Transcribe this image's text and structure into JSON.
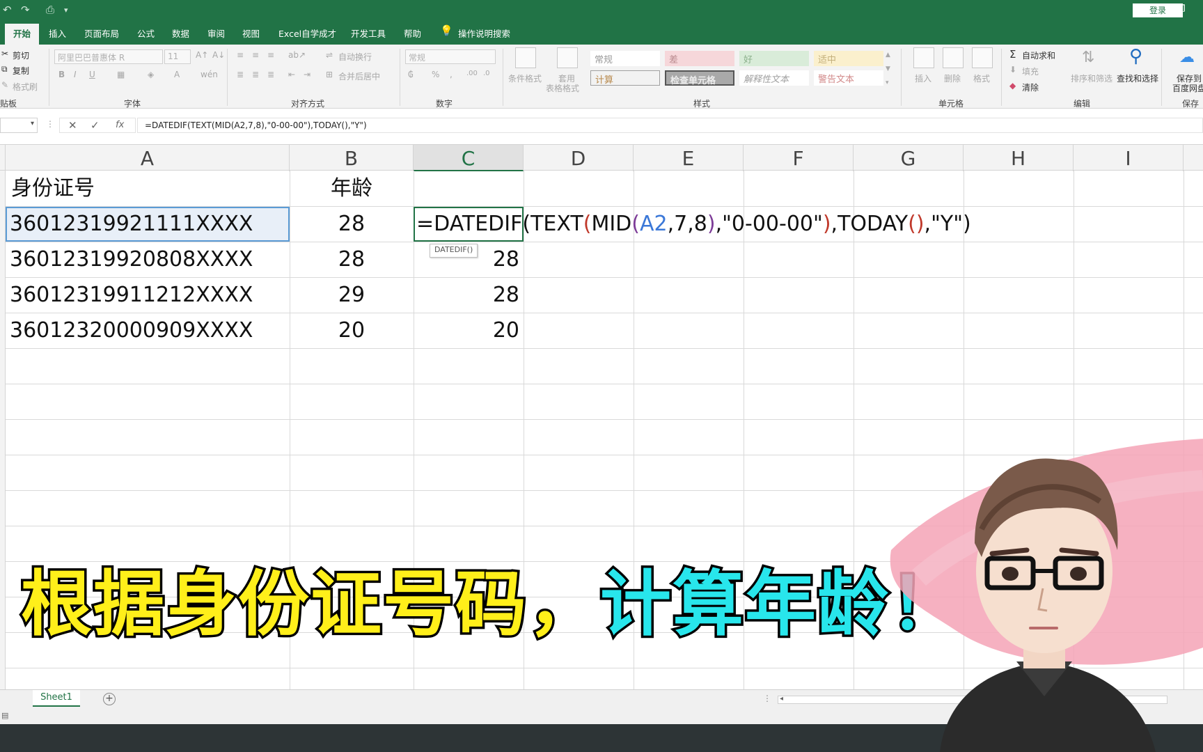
{
  "titlebar": {
    "login_label": "登录"
  },
  "tabs": [
    "开始",
    "插入",
    "页面布局",
    "公式",
    "数据",
    "审阅",
    "视图",
    "Excel自学成才",
    "开发工具",
    "帮助",
    "操作说明搜索"
  ],
  "ribbon": {
    "clipboard": {
      "cut": "剪切",
      "copy": "复制",
      "format_painter": "格式刷",
      "group": "贴板"
    },
    "font": {
      "font_name": "阿里巴巴普惠体 R",
      "font_size": "11",
      "group": "字体"
    },
    "alignment": {
      "wrap": "自动换行",
      "merge": "合并后居中",
      "group": "对齐方式"
    },
    "number": {
      "format": "常规",
      "group": "数字"
    },
    "styles": {
      "cond_format": "条件格式",
      "table_format_1": "套用",
      "table_format_2": "表格格式",
      "normal": "常规",
      "bad": "差",
      "good": "好",
      "neutral": "适中",
      "calc": "计算",
      "check_cell": "检查单元格",
      "explanatory": "解释性文本",
      "warning": "警告文本",
      "group": "样式"
    },
    "cells": {
      "insert": "插入",
      "delete": "删除",
      "format": "格式",
      "group": "单元格"
    },
    "editing": {
      "autosum": "自动求和",
      "fill": "填充",
      "clear": "清除",
      "sort": "排序和筛选",
      "find": "查找和选择",
      "group": "编辑"
    },
    "save": {
      "label_1": "保存到",
      "label_2": "百度网盘",
      "group": "保存"
    }
  },
  "formula_bar": {
    "fx": "fx",
    "formula": "=DATEDIF(TEXT(MID(A2,7,8),\"0-00-00\"),TODAY(),\"Y\")"
  },
  "columns": [
    "A",
    "B",
    "C",
    "D",
    "E",
    "F",
    "G",
    "H",
    "I"
  ],
  "selected_column": "C",
  "rows": [
    {
      "a": "身份证号",
      "b": "年龄",
      "c": ""
    },
    {
      "a": "36012319921111XXXX",
      "b": "28",
      "c": ""
    },
    {
      "a": "36012319920808XXXX",
      "b": "28",
      "c": "28"
    },
    {
      "a": "36012319911212XXXX",
      "b": "29",
      "c": "28"
    },
    {
      "a": "36012320000909XXXX",
      "b": "20",
      "c": "20"
    }
  ],
  "editing_cell": {
    "tokens": [
      {
        "text": "=DATEDIF(",
        "color": "#111111"
      },
      {
        "text": "TEXT",
        "color": "#111111"
      },
      {
        "text": "(",
        "color": "#c0392b"
      },
      {
        "text": "MID",
        "color": "#111111"
      },
      {
        "text": "(",
        "color": "#7d3c98"
      },
      {
        "text": "A2",
        "color": "#3b78d8"
      },
      {
        "text": ",7,8",
        "color": "#111111"
      },
      {
        "text": ")",
        "color": "#7d3c98"
      },
      {
        "text": ",\"0-00-00\"",
        "color": "#111111"
      },
      {
        "text": ")",
        "color": "#c0392b"
      },
      {
        "text": ",TODAY",
        "color": "#111111"
      },
      {
        "text": "()",
        "color": "#c0392b"
      },
      {
        "text": ",\"Y\")",
        "color": "#111111"
      }
    ],
    "tooltip": "DATEDIF()"
  },
  "sheet_tab": "Sheet1",
  "caption": {
    "part1": "根据身份证号码，",
    "part2": "计算年龄！"
  },
  "colors": {
    "excel_green": "#217346",
    "caption_yellow": "#ffef1a",
    "caption_cyan": "#28e6ec"
  }
}
